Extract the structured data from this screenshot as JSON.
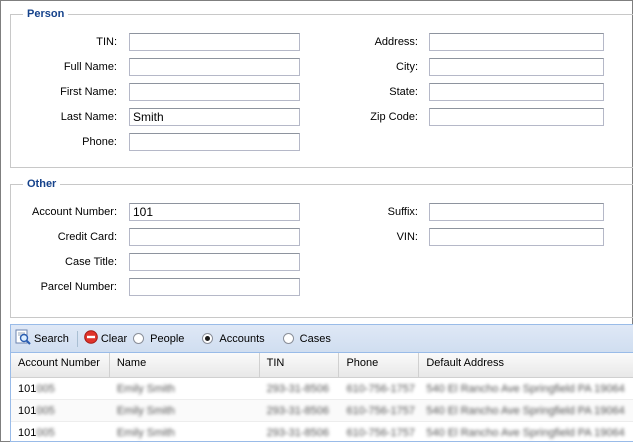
{
  "person": {
    "legend": "Person",
    "tin_label": "TIN:",
    "tin_value": "",
    "full_name_label": "Full Name:",
    "full_name_value": "",
    "first_name_label": "First Name:",
    "first_name_value": "",
    "last_name_label": "Last Name:",
    "last_name_value": "Smith",
    "phone_label": "Phone:",
    "phone_value": "",
    "address_label": "Address:",
    "address_value": "",
    "city_label": "City:",
    "city_value": "",
    "state_label": "State:",
    "state_value": "",
    "zip_label": "Zip Code:",
    "zip_value": ""
  },
  "other": {
    "legend": "Other",
    "account_number_label": "Account Number:",
    "account_number_value": "101",
    "credit_card_label": "Credit Card:",
    "credit_card_value": "",
    "case_title_label": "Case Title:",
    "case_title_value": "",
    "parcel_number_label": "Parcel Number:",
    "parcel_number_value": "",
    "suffix_label": "Suffix:",
    "suffix_value": "",
    "vin_label": "VIN:",
    "vin_value": ""
  },
  "toolbar": {
    "search_label": "Search",
    "clear_label": "Clear",
    "people_label": "People",
    "accounts_label": "Accounts",
    "cases_label": "Cases",
    "selected_scope": "Accounts"
  },
  "grid": {
    "columns": [
      "Account Number",
      "Name",
      "TIN",
      "Phone",
      "Default Address"
    ],
    "rows": [
      {
        "account_prefix": "101",
        "account_rest": "005",
        "name": "Emily Smith",
        "tin": "293-31-8506",
        "phone": "610-756-1757",
        "address": "540 El Rancho Ave Springfield PA 19064"
      },
      {
        "account_prefix": "101",
        "account_rest": "005",
        "name": "Emily Smith",
        "tin": "293-31-8506",
        "phone": "610-756-1757",
        "address": "540 El Rancho Ave Springfield PA 19064"
      },
      {
        "account_prefix": "101",
        "account_rest": "005",
        "name": "Emily Smith",
        "tin": "293-31-8506",
        "phone": "610-756-1757",
        "address": "540 El Rancho Ave Springfield PA 19064"
      }
    ]
  }
}
